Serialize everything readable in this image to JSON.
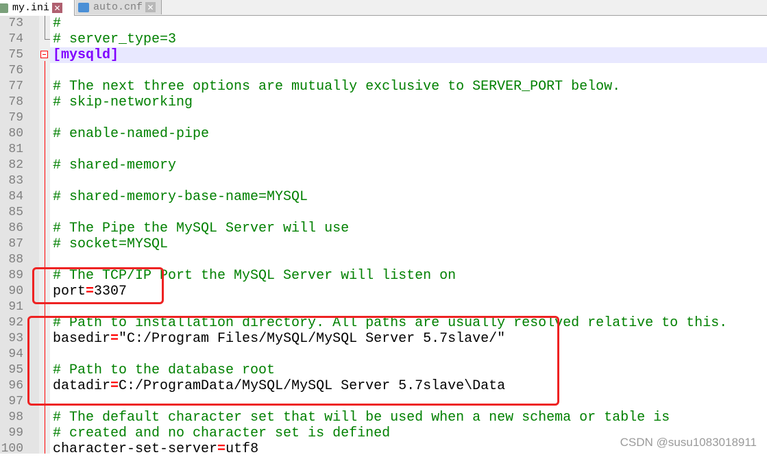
{
  "tabs": [
    {
      "label": "my.ini",
      "active": true
    },
    {
      "label": "auto.cnf",
      "active": false
    }
  ],
  "current_line": 75,
  "lines": [
    {
      "num": "73",
      "comment": "#"
    },
    {
      "num": "74",
      "comment": "# server_type=3"
    },
    {
      "num": "75",
      "section": "[mysqld]"
    },
    {
      "num": "76"
    },
    {
      "num": "77",
      "comment": "# The next three options are mutually exclusive to SERVER_PORT below."
    },
    {
      "num": "78",
      "comment": "# skip-networking"
    },
    {
      "num": "79"
    },
    {
      "num": "80",
      "comment": "# enable-named-pipe"
    },
    {
      "num": "81"
    },
    {
      "num": "82",
      "comment": "# shared-memory"
    },
    {
      "num": "83"
    },
    {
      "num": "84",
      "comment": "# shared-memory-base-name=MYSQL"
    },
    {
      "num": "85"
    },
    {
      "num": "86",
      "comment": "# The Pipe the MySQL Server will use"
    },
    {
      "num": "87",
      "comment": "# socket=MYSQL"
    },
    {
      "num": "88"
    },
    {
      "num": "89",
      "comment": "# The TCP/IP Port the MySQL Server will listen on"
    },
    {
      "num": "90",
      "key": "port",
      "eq": "=",
      "value": "3307"
    },
    {
      "num": "91"
    },
    {
      "num": "92",
      "comment": "# Path to installation directory. All paths are usually resolved relative to this."
    },
    {
      "num": "93",
      "key": "basedir",
      "eq": "=",
      "value": "\"C:/Program Files/MySQL/MySQL Server 5.7slave/\""
    },
    {
      "num": "94"
    },
    {
      "num": "95",
      "comment": "# Path to the database root"
    },
    {
      "num": "96",
      "key": "datadir",
      "eq": "=",
      "value": "C:/ProgramData/MySQL/MySQL Server 5.7slave\\Data"
    },
    {
      "num": "97"
    },
    {
      "num": "98",
      "comment": "# The default character set that will be used when a new schema or table is"
    },
    {
      "num": "99",
      "comment": "# created and no character set is defined"
    },
    {
      "num": "100",
      "key": "character-set-server",
      "eq": "=",
      "value": "utf8"
    }
  ],
  "watermark": "CSDN @susu1083018911",
  "colors": {
    "comment": "#008000",
    "section": "#8000ff",
    "operator": "#ff0000",
    "highlight_box": "#ee2222"
  }
}
